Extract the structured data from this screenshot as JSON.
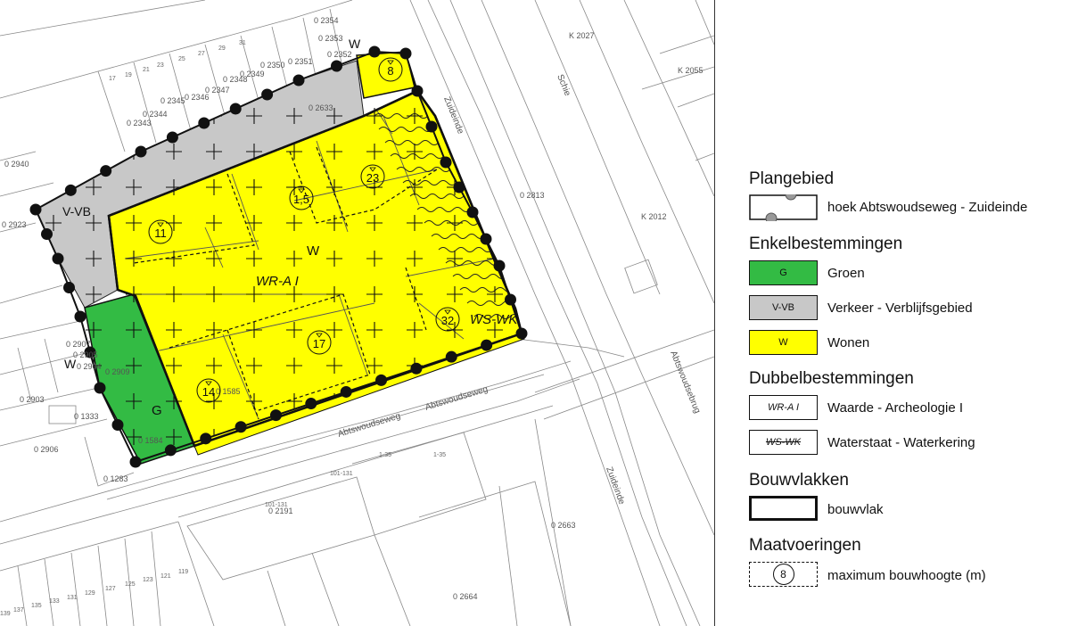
{
  "map": {
    "zone_labels": {
      "v_vb": "V-VB",
      "w_main": "W",
      "w_top": "W",
      "w_left": "W",
      "g": "G",
      "wr_a": "WR-A I",
      "ws_wk": "WS-WK"
    },
    "heights": [
      "8",
      "23",
      "1,5",
      "11",
      "17",
      "32",
      "14"
    ],
    "street_labels": {
      "abtswoudseweg_1": "Abtswoudseweg",
      "abtswoudseweg_2": "Abtswoudseweg",
      "zuideinde_1": "Zuideinde",
      "zuideinde_2": "Zuideinde",
      "schie": "Schie",
      "abtswoudsebrug": "Abtswoudsebrug"
    },
    "parcel_labels": [
      "0 2354",
      "0 2353",
      "0 2352",
      "0 2351",
      "0 2350",
      "0 2349",
      "0 2348",
      "0 2347",
      "0 2346",
      "0 2345",
      "0 2344",
      "0 2343",
      "0 2633",
      "0 2940",
      "0 2923",
      "0 2907",
      "0 2905",
      "0 2904",
      "0 2903",
      "0 2906",
      "0 1333",
      "0 1283",
      "0 2191",
      "0 2664",
      "0 2663",
      "0 2813",
      "K 2027",
      "K 2055",
      "K 2012",
      "0 1584",
      "0 2909",
      "0 1585"
    ],
    "house_numbers": [
      "17",
      "19",
      "21",
      "23",
      "25",
      "27",
      "29",
      "31",
      "139",
      "137",
      "135",
      "133",
      "131",
      "129",
      "127",
      "125",
      "123",
      "121",
      "119",
      "1-35",
      "1-35",
      "101-131",
      "101-131"
    ]
  },
  "legend": {
    "plangebied": {
      "title": "Plangebied",
      "label": "hoek Abtswoudseweg - Zuideinde"
    },
    "enkel": {
      "title": "Enkelbestemmingen",
      "items": [
        {
          "code": "G",
          "label": "Groen",
          "color": "#33bb44"
        },
        {
          "code": "V-VB",
          "label": "Verkeer - Verblijfsgebied",
          "color": "#c8c8c8"
        },
        {
          "code": "W",
          "label": "Wonen",
          "color": "#ffff00"
        }
      ]
    },
    "dubbel": {
      "title": "Dubbelbestemmingen",
      "items": [
        {
          "code": "WR-A I",
          "label": "Waarde - Archeologie I"
        },
        {
          "code": "WS-WK",
          "label": "Waterstaat - Waterkering"
        }
      ]
    },
    "bouwvlakken": {
      "title": "Bouwvlakken",
      "label": "bouwvlak"
    },
    "maatvoeringen": {
      "title": "Maatvoeringen",
      "value": "8",
      "label": "maximum bouwhoogte (m)"
    }
  }
}
